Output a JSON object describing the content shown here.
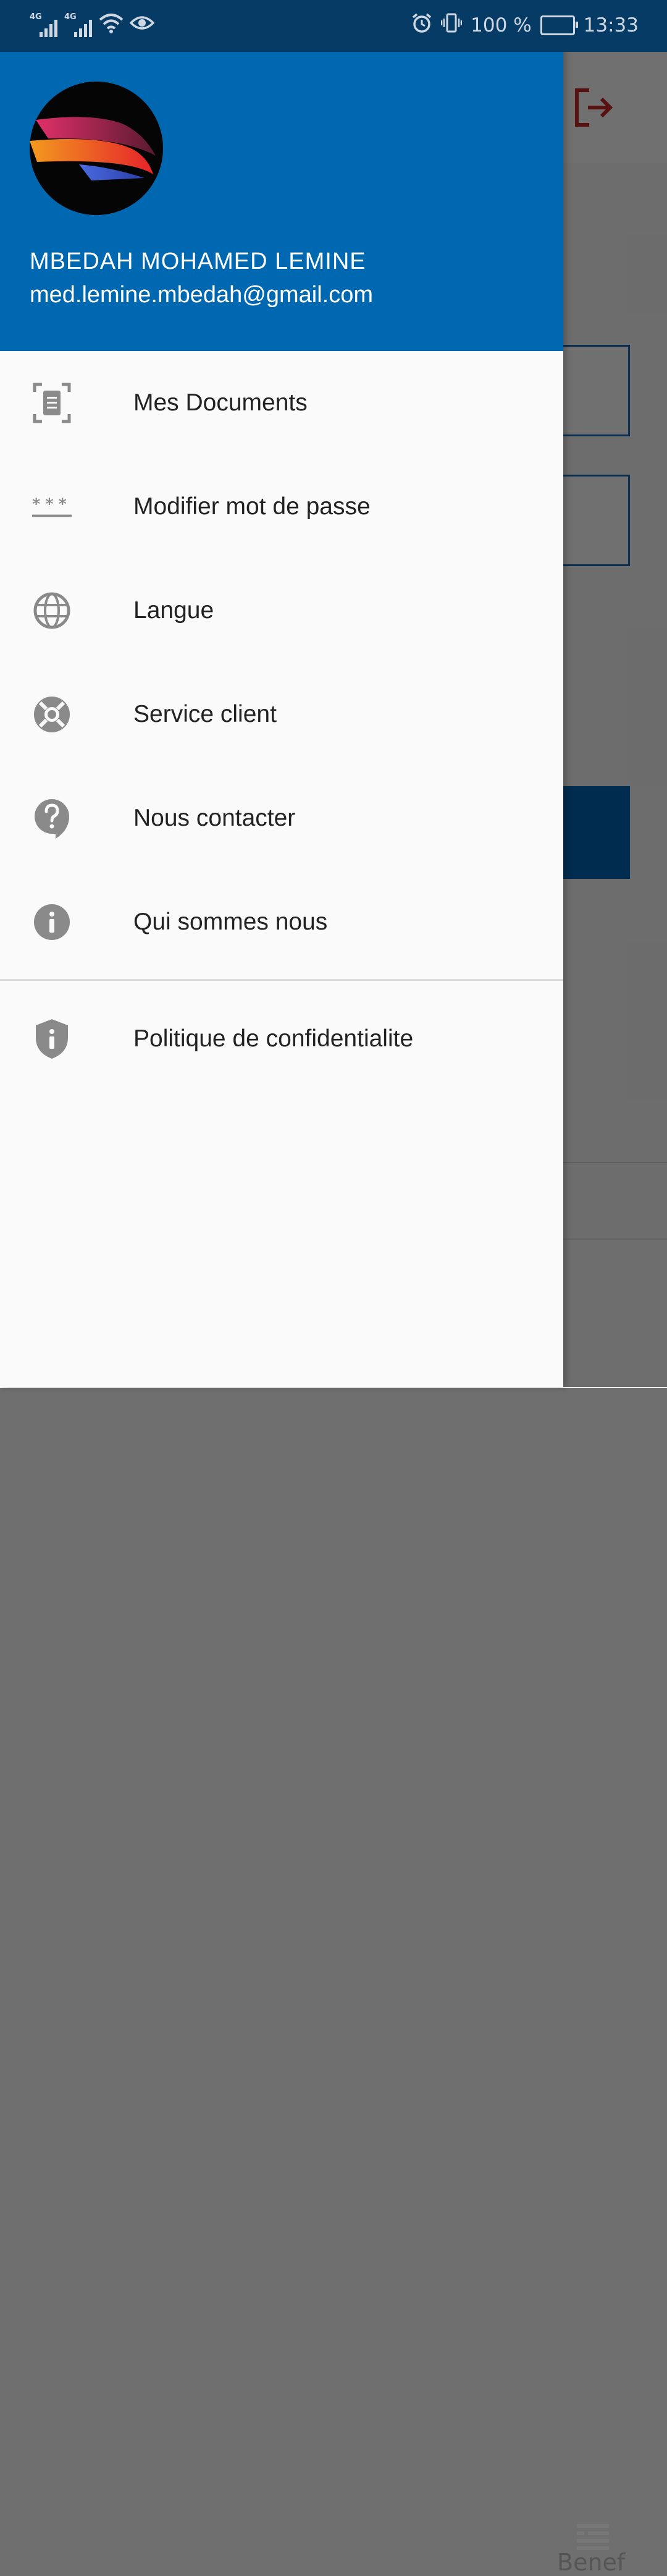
{
  "status_bar": {
    "network_1": "4G",
    "network_2": "4G",
    "battery": "100 %",
    "time": "13:33"
  },
  "drawer": {
    "user": {
      "name": "MBEDAH MOHAMED LEMINE",
      "email": "med.lemine.mbedah@gmail.com"
    },
    "items": [
      {
        "label": "Mes Documents",
        "icon": "document-scan-icon"
      },
      {
        "label": "Modifier mot de passe",
        "icon": "password-icon"
      },
      {
        "label": "Langue",
        "icon": "globe-icon"
      },
      {
        "label": "Service client",
        "icon": "lifebuoy-icon"
      },
      {
        "label": "Nous contacter",
        "icon": "help-bubble-icon"
      },
      {
        "label": "Qui sommes nous",
        "icon": "info-icon"
      }
    ],
    "footer_items": [
      {
        "label": "Politique de confidentialite",
        "icon": "shield-info-icon"
      }
    ]
  },
  "background": {
    "bottom_nav_label": "Benef"
  },
  "colors": {
    "header": "#0068b1",
    "status_bar": "#063b66",
    "icon_gray": "#8a8a8a",
    "logout_red": "#c62828"
  }
}
